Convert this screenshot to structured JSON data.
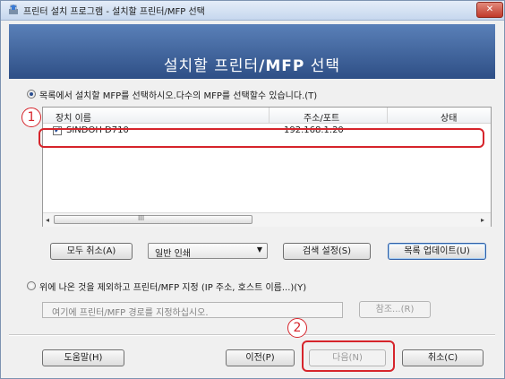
{
  "window": {
    "title": "프린터 설치 프로그램 - 설치할 프린터/MFP 선택",
    "close_label": "✕"
  },
  "banner": {
    "title_prefix": "설치할 프린터",
    "title_bold": "/MFP",
    "title_suffix": " 선택"
  },
  "option_list": {
    "label": "목록에서 설치할 MFP를 선택하시오.다수의 MFP를 선택할수 있습니다.(T)",
    "selected": true
  },
  "device_list": {
    "columns": [
      "장치 이름",
      "주소/포트",
      "상태"
    ],
    "rows": [
      {
        "checked": true,
        "name": "SINDOH D710",
        "address": "192.168.1.20",
        "status": ""
      }
    ],
    "scroll": {
      "left": "◂",
      "grip": "III",
      "right": "▸"
    }
  },
  "list_buttons": {
    "cancel_all": "모두 취소(A)",
    "print_mode": "일반 인쇄",
    "print_mode_arrow": "▼",
    "search_settings": "검색 설정(S)",
    "update_list": "목록 업데이트(U)"
  },
  "option_manual": {
    "label": "위에 나온 것을 제외하고 프린터/MFP 지정 (IP 주소, 호스트 이름...)(Y)",
    "selected": false,
    "path_placeholder": "여기에 프린터/MFP 경로를 지정하십시오.",
    "browse": "참조...(R)"
  },
  "footer": {
    "help": "도움말(H)",
    "back": "이전(P)",
    "next": "다음(N)",
    "cancel": "취소(C)"
  },
  "callouts": [
    "1",
    "2"
  ],
  "colors": {
    "banner": "#2e4f86",
    "highlight": "#d6242b"
  }
}
